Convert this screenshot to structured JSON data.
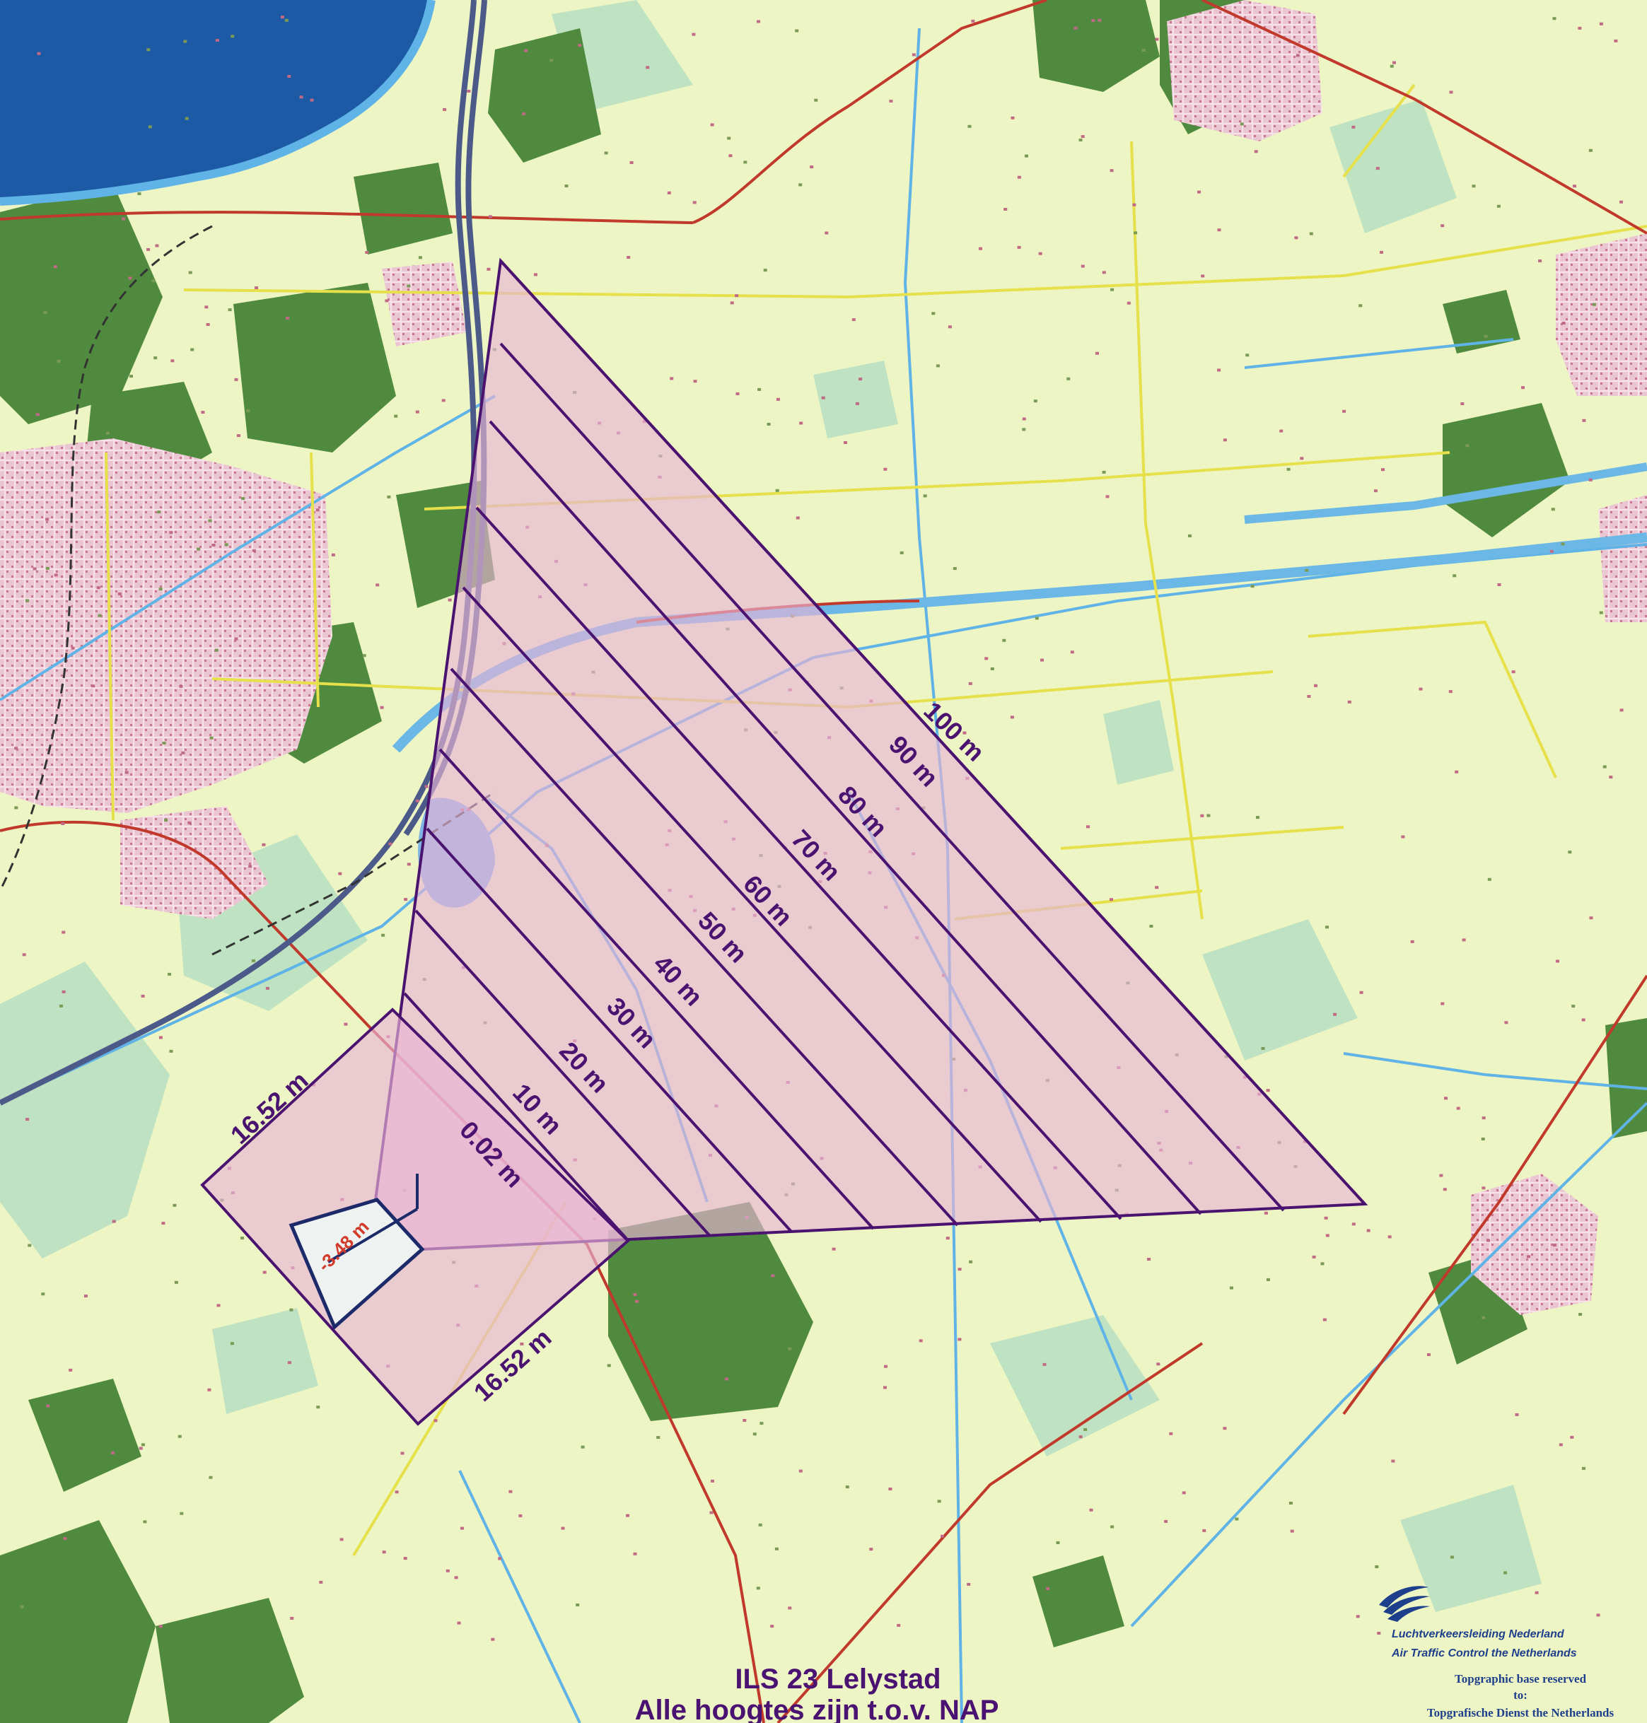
{
  "map": {
    "colors": {
      "land": "#eef5c4",
      "water": "#1d5aa6",
      "forest": "#4f8a3e",
      "meadow": "#b9e0c0",
      "urban": "#e7c3cf",
      "road_main": "#c0392b",
      "road_secondary": "#e6e04a",
      "canal": "#5fb3e6",
      "highway": "#4b5a88",
      "zone_fill": "#e8b4d6",
      "zone_stroke": "#4a1370",
      "label": "#4a1370",
      "threshold_label": "#d23a2a"
    }
  },
  "zone_labels": {
    "m100": "100 m",
    "m90": "90 m",
    "m80": "80 m",
    "m70": "70 m",
    "m60": "60 m",
    "m50": "50 m",
    "m40": "40 m",
    "m30": "30 m",
    "m20": "20 m",
    "m10": "10 m",
    "m002": "0.02 m",
    "side_top": "16.52 m",
    "side_bottom": "16.52 m",
    "threshold": "-3.48 m"
  },
  "title": {
    "line1": "ILS 23 Lelystad",
    "line2": "Alle hoogtes zijn t.o.v. NAP"
  },
  "credits": {
    "logo_icon": "lvnl-swoosh-logo",
    "org_line1": "Luchtverkeersleiding Nederland",
    "org_line2": "Air Traffic Control the Netherlands",
    "base_line1": "Topgraphic base reserved",
    "base_line2": "to:",
    "base_line3": "Topgrafische Dienst the Netherlands"
  }
}
